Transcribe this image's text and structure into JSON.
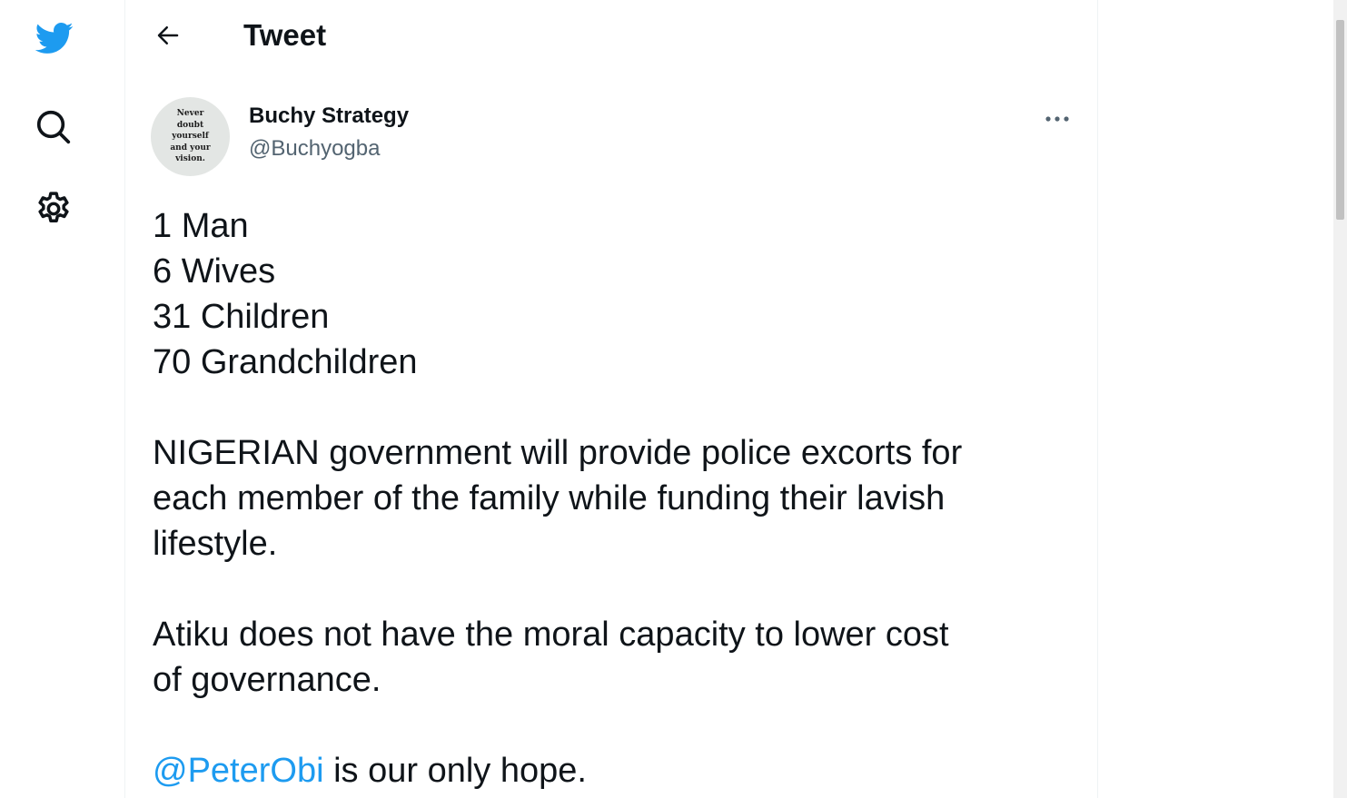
{
  "nav": {
    "items": [
      {
        "icon": "twitter-bird-icon"
      },
      {
        "icon": "search-icon"
      },
      {
        "icon": "settings-gear-icon"
      }
    ]
  },
  "header": {
    "back_icon": "arrow-left-icon",
    "title": "Tweet"
  },
  "tweet": {
    "author": {
      "avatar_text": [
        "Never",
        "doubt",
        "yourself",
        "and your",
        "vision."
      ],
      "display_name": "Buchy Strategy",
      "handle": "@Buchyogba"
    },
    "more_icon": "more-dots-icon",
    "lines1": [
      "1 Man",
      "6 Wives",
      "31 Children",
      "70 Grandchildren"
    ],
    "para2_lines": [
      "NIGERIAN government will provide police excorts for",
      "each member of the family while funding their lavish",
      "lifestyle."
    ],
    "para3_lines": [
      "Atiku does not have the moral capacity to lower cost",
      "of governance."
    ],
    "mention": "@PeterObi",
    "mention_suffix": " is our only hope."
  },
  "colors": {
    "brand": "#1d9bf0",
    "text": "#0f1419",
    "secondary": "#536471"
  }
}
